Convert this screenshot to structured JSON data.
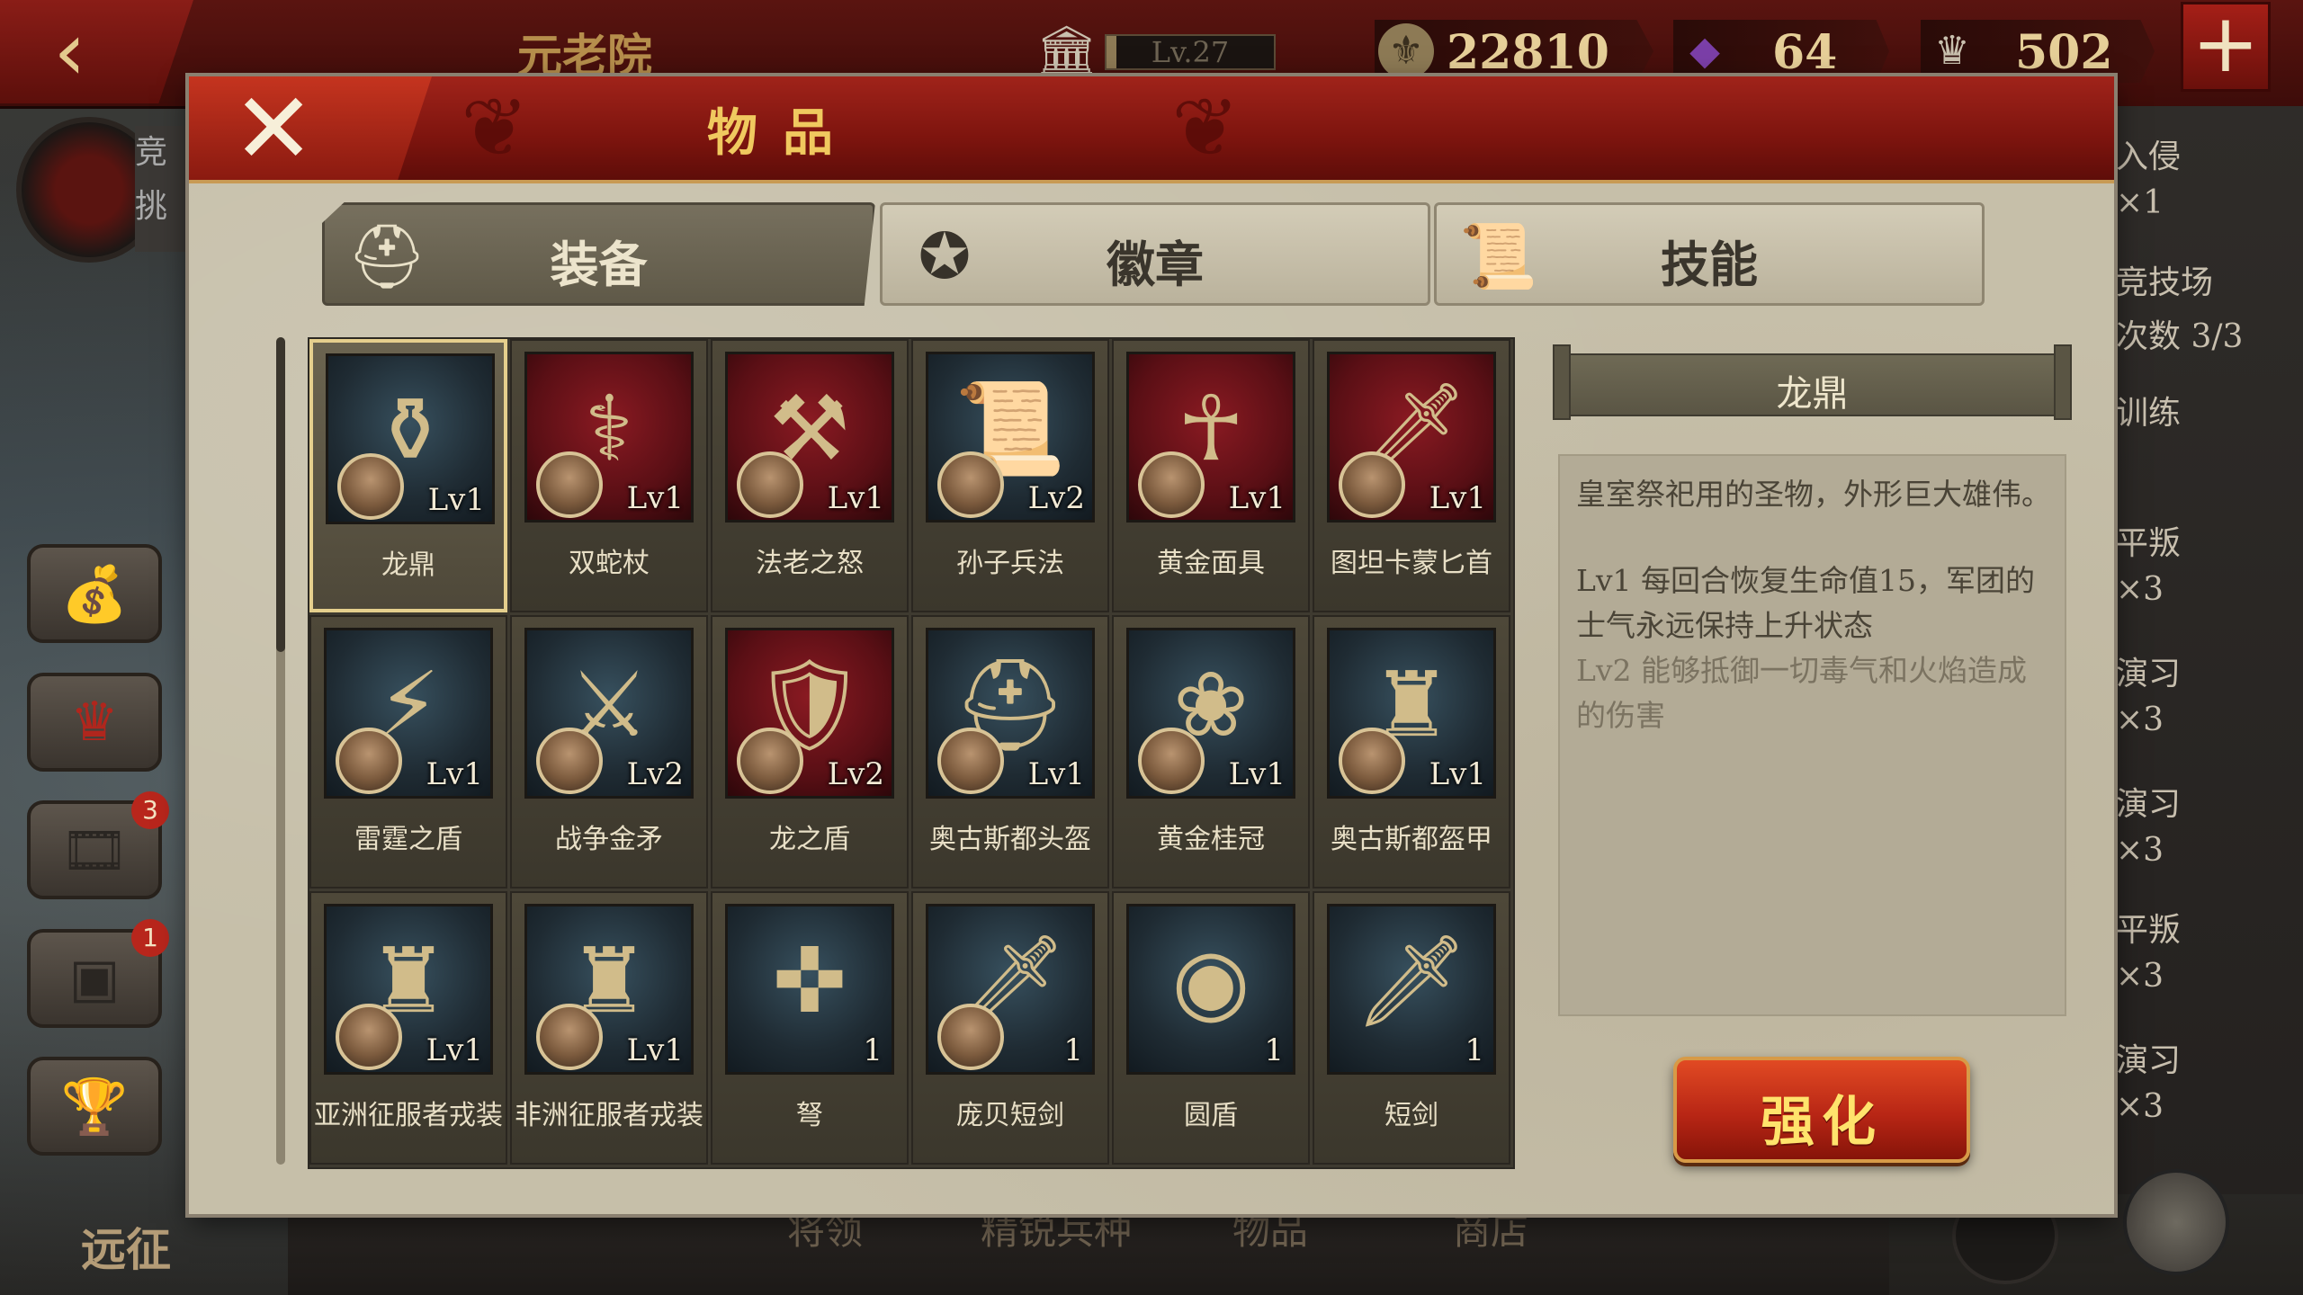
{
  "topbar": {
    "back_icon": "back-arrow-icon",
    "title": "元老院",
    "level": "Lv.27",
    "level_progress": 0.06,
    "resources": [
      {
        "name": "coin",
        "icon": "coin-icon",
        "value": "22810"
      },
      {
        "name": "gem",
        "icon": "gem-icon",
        "value": "64"
      },
      {
        "name": "spqr",
        "icon": "eagle-icon",
        "value": "502"
      }
    ],
    "plus_icon": "plus-icon"
  },
  "left": {
    "panel_line1": "竞",
    "panel_line2": "挑",
    "badges": [
      "3",
      "1"
    ],
    "expedition": "远征"
  },
  "bottom_tabs": [
    "将领",
    "精锐兵种",
    "物品",
    "商店"
  ],
  "right_list": [
    "入侵",
    "×1",
    "竞技场",
    "次数 3/3",
    "训练",
    "平叛",
    "×3",
    "演习",
    "×3",
    "演习",
    "×3",
    "平叛",
    "×3",
    "演习",
    "×3"
  ],
  "modal": {
    "title": "物品",
    "close_icon": "close-icon",
    "tabs": [
      {
        "label": "装备",
        "icon": "helmet-icon",
        "active": true
      },
      {
        "label": "徽章",
        "icon": "badge-emblem-icon",
        "active": false
      },
      {
        "label": "技能",
        "icon": "scroll-icon",
        "active": false
      }
    ],
    "items": [
      {
        "name": "龙鼎",
        "level": "Lv1",
        "qty": "",
        "hero": true,
        "bg": "blue",
        "glyph": "⚱",
        "selected": true
      },
      {
        "name": "双蛇杖",
        "level": "Lv1",
        "qty": "",
        "hero": true,
        "bg": "red",
        "glyph": "⚕"
      },
      {
        "name": "法老之怒",
        "level": "Lv1",
        "qty": "",
        "hero": true,
        "bg": "red",
        "glyph": "⚒"
      },
      {
        "name": "孙子兵法",
        "level": "Lv2",
        "qty": "",
        "hero": true,
        "bg": "blue",
        "glyph": "📜"
      },
      {
        "name": "黄金面具",
        "level": "Lv1",
        "qty": "",
        "hero": true,
        "bg": "red",
        "glyph": "☥"
      },
      {
        "name": "图坦卡蒙匕首",
        "level": "Lv1",
        "qty": "",
        "hero": true,
        "bg": "red",
        "glyph": "🗡"
      },
      {
        "name": "雷霆之盾",
        "level": "Lv1",
        "qty": "",
        "hero": true,
        "bg": "blue",
        "glyph": "⚡"
      },
      {
        "name": "战争金矛",
        "level": "Lv2",
        "qty": "",
        "hero": true,
        "bg": "blue",
        "glyph": "⚔"
      },
      {
        "name": "龙之盾",
        "level": "Lv2",
        "qty": "",
        "hero": true,
        "bg": "red",
        "glyph": "🛡"
      },
      {
        "name": "奥古斯都头盔",
        "level": "Lv1",
        "qty": "",
        "hero": true,
        "bg": "blue",
        "glyph": "⛑"
      },
      {
        "name": "黄金桂冠",
        "level": "Lv1",
        "qty": "",
        "hero": true,
        "bg": "blue",
        "glyph": "❀"
      },
      {
        "name": "奥古斯都盔甲",
        "level": "Lv1",
        "qty": "",
        "hero": true,
        "bg": "blue",
        "glyph": "♜"
      },
      {
        "name": "亚洲征服者戎装",
        "level": "Lv1",
        "qty": "",
        "hero": true,
        "bg": "blue",
        "glyph": "♜"
      },
      {
        "name": "非洲征服者戎装",
        "level": "Lv1",
        "qty": "",
        "hero": true,
        "bg": "blue",
        "glyph": "♜"
      },
      {
        "name": "弩",
        "level": "",
        "qty": "1",
        "hero": false,
        "bg": "blue",
        "glyph": "✜"
      },
      {
        "name": "庞贝短剑",
        "level": "",
        "qty": "1",
        "hero": true,
        "bg": "blue",
        "glyph": "🗡"
      },
      {
        "name": "圆盾",
        "level": "",
        "qty": "1",
        "hero": false,
        "bg": "blue",
        "glyph": "◉"
      },
      {
        "name": "短剑",
        "level": "",
        "qty": "1",
        "hero": false,
        "bg": "blue",
        "glyph": "🗡"
      }
    ],
    "detail": {
      "title": "龙鼎",
      "description": "皇室祭祀用的圣物，外形巨大雄伟。",
      "effect_lv1": "Lv1 每回合恢复生命值15，军团的士气永远保持上升状态",
      "effect_lv2": "Lv2 能够抵御一切毒气和火焰造成的伤害"
    },
    "upgrade_label": "强化"
  },
  "colors": {
    "accent_red": "#9f2219",
    "panel_beige": "#c6bfa9",
    "gold_text": "#f0c95f",
    "button_text": "#ffe36c"
  }
}
